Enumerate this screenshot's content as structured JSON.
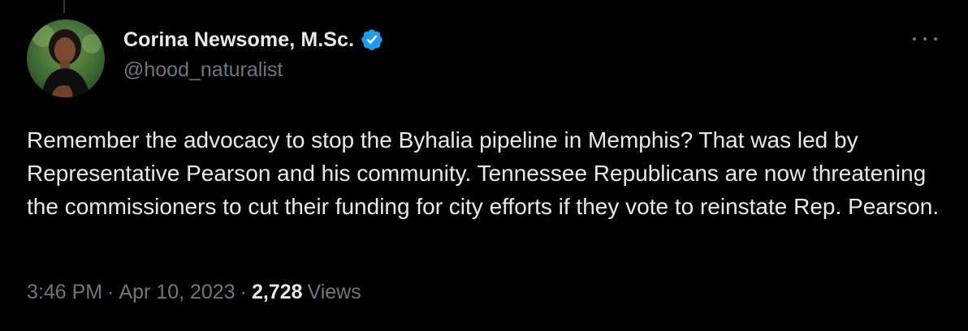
{
  "tweet": {
    "author": {
      "display_name": "Corina Newsome, M.Sc.",
      "handle": "@hood_naturalist",
      "verified": true,
      "avatar_icon": "profile-photo",
      "verified_icon": "verified-badge-icon"
    },
    "text": "Remember the advocacy to stop the Byhalia pipeline in Memphis? That was led by Representative Pearson and his community. Tennessee Republicans are now threatening the commissioners to cut their funding for city efforts if they vote to reinstate Rep. Pearson.",
    "time": "3:46 PM",
    "separator": "·",
    "date": "Apr 10, 2023",
    "views_count": "2,728",
    "views_label": "Views"
  },
  "colors": {
    "background": "#000000",
    "primary_text": "#e7e9ea",
    "secondary_text": "#71767b",
    "verified_blue": "#1d9bf0"
  }
}
